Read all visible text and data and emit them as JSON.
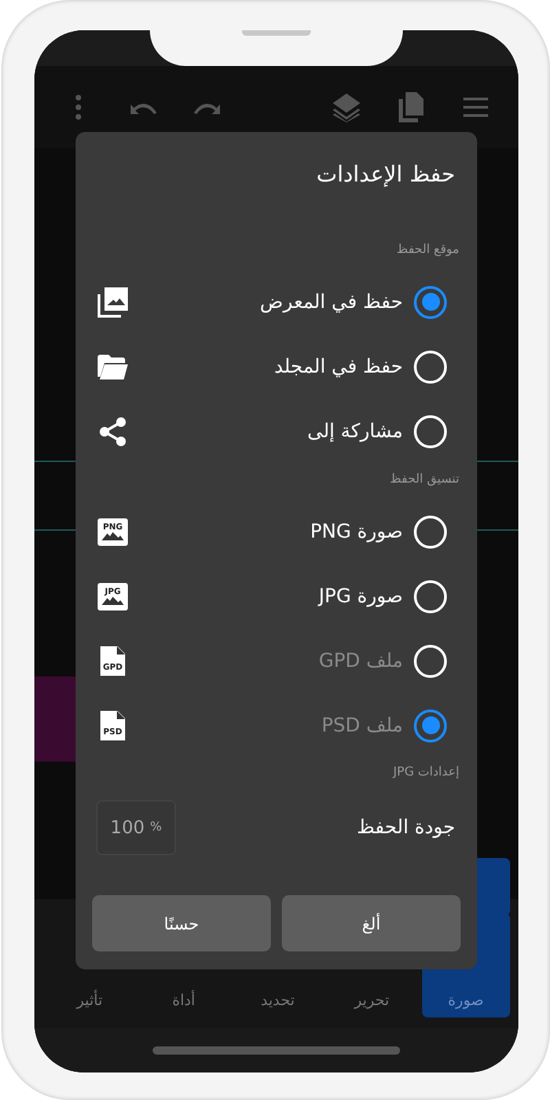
{
  "toolbar": {
    "items": [
      {
        "kind": "more"
      },
      {
        "kind": "undo"
      },
      {
        "kind": "redo"
      },
      {
        "kind": "layers"
      },
      {
        "kind": "pages"
      },
      {
        "kind": "menu"
      }
    ]
  },
  "bottom_nav": [
    {
      "label": "صورة",
      "selected": true
    },
    {
      "label": "تحرير",
      "selected": false
    },
    {
      "label": "تحديد",
      "selected": false
    },
    {
      "label": "أداة",
      "selected": false
    },
    {
      "label": "تأثير",
      "selected": false
    }
  ],
  "dialog": {
    "title": "حفظ الإعدادات",
    "location_section": "موقع الحفظ",
    "locations": [
      {
        "label": "حفظ في المعرض",
        "kind": "gallery",
        "selected": true
      },
      {
        "label": "حفظ في المجلد",
        "kind": "folder",
        "selected": false
      },
      {
        "label": "مشاركة إلى",
        "kind": "share",
        "selected": false
      }
    ],
    "format_section": "تنسيق الحفظ",
    "formats": [
      {
        "label": "صورة PNG",
        "kind": "image",
        "badge": "PNG",
        "selected": false,
        "disabled": false
      },
      {
        "label": "صورة JPG",
        "kind": "image",
        "badge": "JPG",
        "selected": false,
        "disabled": false
      },
      {
        "label": "ملف GPD",
        "kind": "file",
        "badge": "GPD",
        "selected": false,
        "disabled": true
      },
      {
        "label": "ملف PSD",
        "kind": "file",
        "badge": "PSD",
        "selected": true,
        "disabled": true
      }
    ],
    "jpg_section": "إعدادات JPG",
    "quality": {
      "label": "جودة الحفظ",
      "value": "100",
      "unit": "%"
    },
    "buttons": [
      "ألغ",
      "حسنًا"
    ]
  }
}
